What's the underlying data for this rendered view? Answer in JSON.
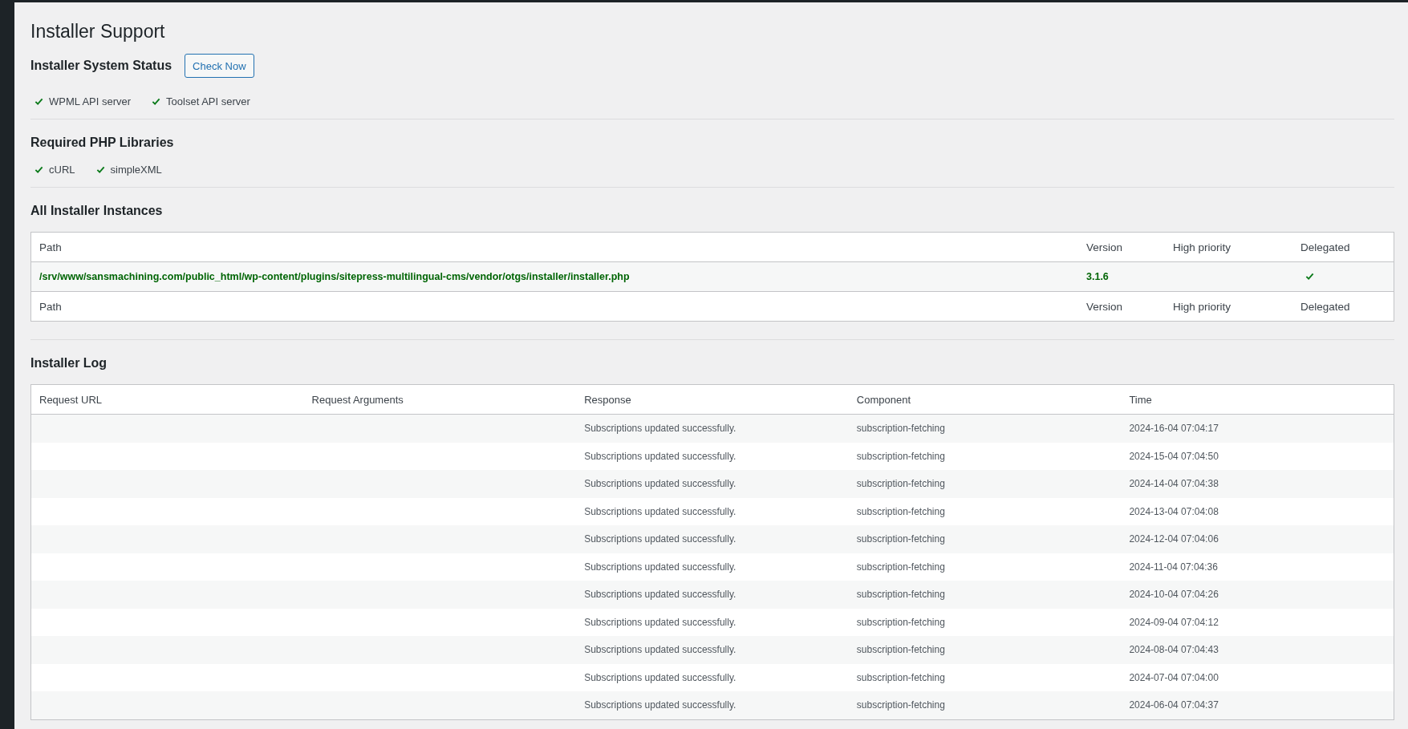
{
  "page_title": "Installer Support",
  "system_status": {
    "title": "Installer System Status",
    "button": "Check Now",
    "items": [
      {
        "label": "WPML API server",
        "ok": true
      },
      {
        "label": "Toolset API server",
        "ok": true
      }
    ]
  },
  "php_libraries": {
    "title": "Required PHP Libraries",
    "items": [
      {
        "label": "cURL",
        "ok": true
      },
      {
        "label": "simpleXML",
        "ok": true
      }
    ]
  },
  "instances": {
    "title": "All Installer Instances",
    "columns": [
      "Path",
      "Version",
      "High priority",
      "Delegated"
    ],
    "rows": [
      {
        "path": "/srv/www/sansmachining.com/public_html/wp-content/plugins/sitepress-multilingual-cms/vendor/otgs/installer/installer.php",
        "version": "3.1.6",
        "high_priority": false,
        "delegated": true
      }
    ],
    "footer_columns": [
      "Path",
      "Version",
      "High priority",
      "Delegated"
    ]
  },
  "log": {
    "title": "Installer Log",
    "columns": [
      "Request URL",
      "Request Arguments",
      "Response",
      "Component",
      "Time"
    ],
    "rows": [
      {
        "response": "Subscriptions updated successfully.",
        "component": "subscription-fetching",
        "time": "2024-16-04 07:04:17"
      },
      {
        "response": "Subscriptions updated successfully.",
        "component": "subscription-fetching",
        "time": "2024-15-04 07:04:50"
      },
      {
        "response": "Subscriptions updated successfully.",
        "component": "subscription-fetching",
        "time": "2024-14-04 07:04:38"
      },
      {
        "response": "Subscriptions updated successfully.",
        "component": "subscription-fetching",
        "time": "2024-13-04 07:04:08"
      },
      {
        "response": "Subscriptions updated successfully.",
        "component": "subscription-fetching",
        "time": "2024-12-04 07:04:06"
      },
      {
        "response": "Subscriptions updated successfully.",
        "component": "subscription-fetching",
        "time": "2024-11-04 07:04:36"
      },
      {
        "response": "Subscriptions updated successfully.",
        "component": "subscription-fetching",
        "time": "2024-10-04 07:04:26"
      },
      {
        "response": "Subscriptions updated successfully.",
        "component": "subscription-fetching",
        "time": "2024-09-04 07:04:12"
      },
      {
        "response": "Subscriptions updated successfully.",
        "component": "subscription-fetching",
        "time": "2024-08-04 07:04:43"
      },
      {
        "response": "Subscriptions updated successfully.",
        "component": "subscription-fetching",
        "time": "2024-07-04 07:04:00"
      },
      {
        "response": "Subscriptions updated successfully.",
        "component": "subscription-fetching",
        "time": "2024-06-04 07:04:37"
      }
    ]
  }
}
